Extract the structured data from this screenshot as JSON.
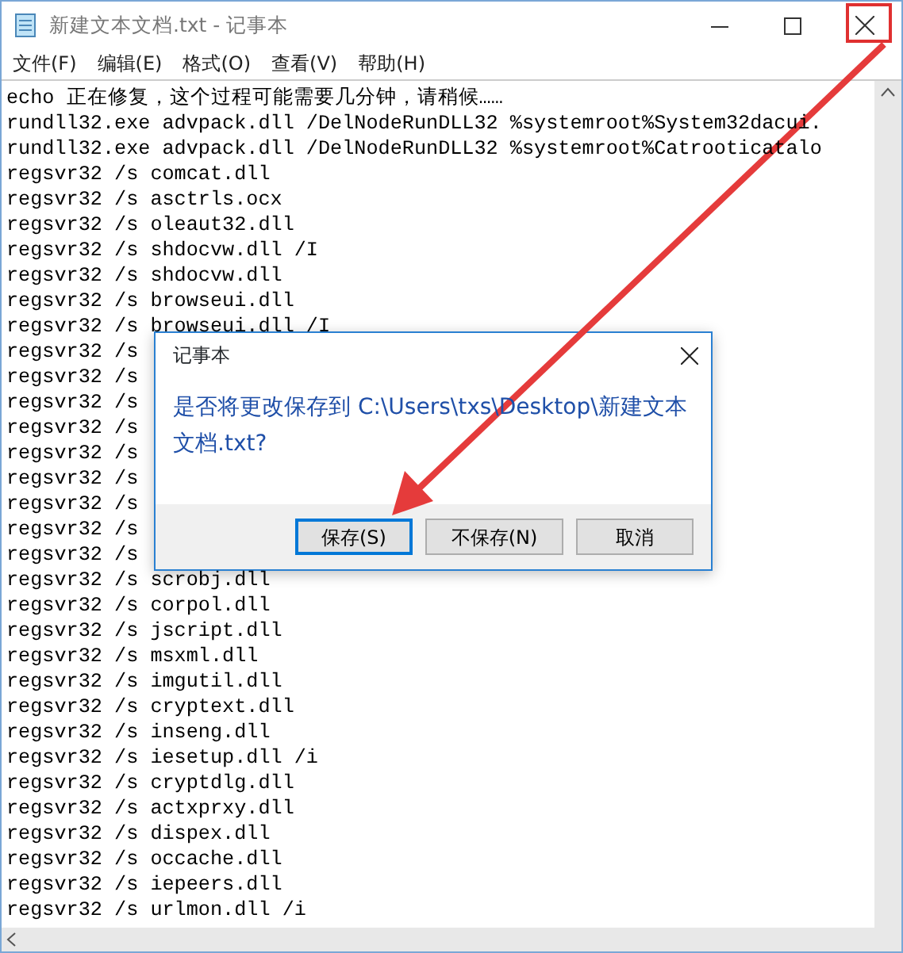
{
  "window": {
    "title": "新建文本文档.txt - 记事本"
  },
  "menu": [
    "文件(F)",
    "编辑(E)",
    "格式(O)",
    "查看(V)",
    "帮助(H)"
  ],
  "editor": {
    "lines": [
      "echo 正在修复，这个过程可能需要几分钟，请稍候……",
      "rundll32.exe advpack.dll /DelNodeRunDLL32 %systemroot%System32dacui.",
      "rundll32.exe advpack.dll /DelNodeRunDLL32 %systemroot%Catrooticatalo",
      "regsvr32 /s comcat.dll",
      "regsvr32 /s asctrls.ocx",
      "regsvr32 /s oleaut32.dll",
      "regsvr32 /s shdocvw.dll /I",
      "regsvr32 /s shdocvw.dll",
      "regsvr32 /s browseui.dll",
      "regsvr32 /s browseui.dll /I",
      "regsvr32 /s",
      "regsvr32 /s",
      "regsvr32 /s",
      "regsvr32 /s",
      "regsvr32 /s",
      "regsvr32 /s",
      "regsvr32 /s",
      "regsvr32 /s",
      "regsvr32 /s",
      "regsvr32 /s scrobj.dll",
      "regsvr32 /s corpol.dll",
      "regsvr32 /s jscript.dll",
      "regsvr32 /s msxml.dll",
      "regsvr32 /s imgutil.dll",
      "regsvr32 /s cryptext.dll",
      "regsvr32 /s inseng.dll",
      "regsvr32 /s iesetup.dll /i",
      "regsvr32 /s cryptdlg.dll",
      "regsvr32 /s actxprxy.dll",
      "regsvr32 /s dispex.dll",
      "regsvr32 /s occache.dll",
      "regsvr32 /s iepeers.dll",
      "regsvr32 /s urlmon.dll /i"
    ]
  },
  "dialog": {
    "title": "记事本",
    "message": "是否将更改保存到 C:\\Users\\txs\\Desktop\\新建文本文档.txt?",
    "buttons": [
      {
        "label": "保存(S)",
        "default": true
      },
      {
        "label": "不保存(N)",
        "default": false
      },
      {
        "label": "取消",
        "default": false
      }
    ]
  }
}
